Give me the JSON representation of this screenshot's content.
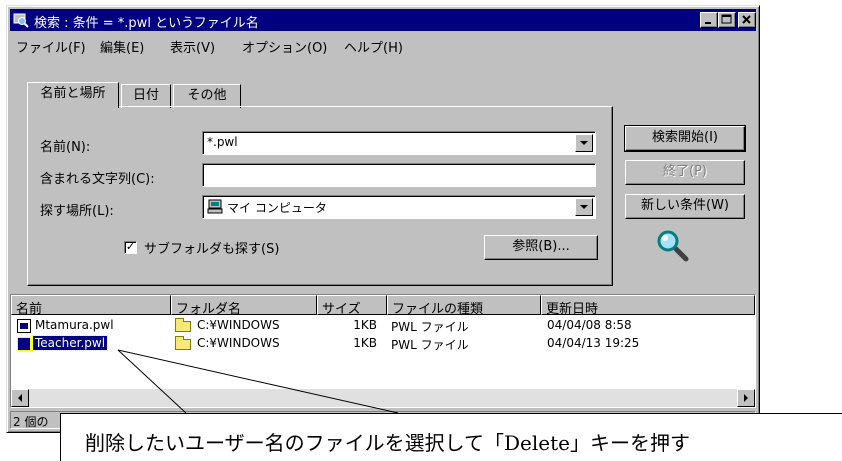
{
  "window": {
    "title": "検索 : 条件 = *.pwl というファイル名"
  },
  "menu": [
    "ファイル(F)",
    "編集(E)",
    "表示(V)",
    "オプション(O)",
    "ヘルプ(H)"
  ],
  "tabs": [
    "名前と場所",
    "日付",
    "その他"
  ],
  "form": {
    "name_label": "名前(N):",
    "name_value": "*.pwl",
    "contains_label": "含まれる文字列(C):",
    "contains_value": "",
    "lookin_label": "探す場所(L):",
    "lookin_value": "マイ コンピュータ",
    "subfolders_label": "サブフォルダも探す(S)",
    "subfolders_checked": true,
    "browse_label": "参照(B)..."
  },
  "buttons": {
    "find_now": "検索開始(I)",
    "stop": "終了(P)",
    "new_search": "新しい条件(W)"
  },
  "columns": [
    "名前",
    "フォルダ名",
    "サイズ",
    "ファイルの種類",
    "更新日時"
  ],
  "rows": [
    {
      "name": "Mtamura.pwl",
      "folder": "C:¥WINDOWS",
      "size": "1KB",
      "type": "PWL ファイル",
      "modified": "04/04/08 8:58",
      "selected": false
    },
    {
      "name": "Teacher.pwl",
      "folder": "C:¥WINDOWS",
      "size": "1KB",
      "type": "PWL ファイル",
      "modified": "04/04/13 19:25",
      "selected": true
    }
  ],
  "status": "2 個の",
  "callout": "削除したいユーザー名のファイルを選択して「Delete」キーを押す",
  "colors": {
    "titlebar": "#000080",
    "face": "#c0c0c0",
    "selection": "#000080"
  },
  "icons": {
    "window": "find-window-icon",
    "search": "magnifier-icon",
    "folder": "folder-icon",
    "file": "pwl-file-icon"
  }
}
